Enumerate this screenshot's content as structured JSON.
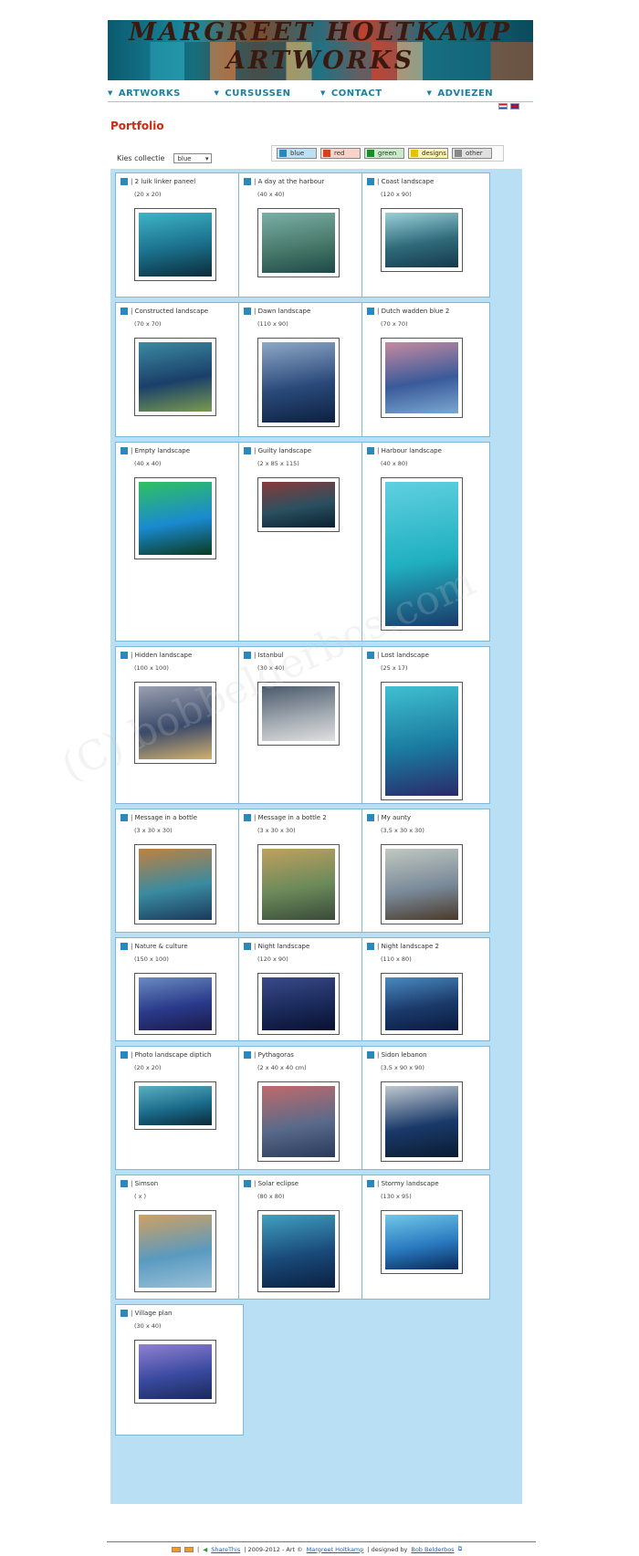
{
  "site_title": "MARGREET HOLTKAMP ARTWORKS",
  "nav": [
    "ARTWORKS",
    "CURSUSSEN",
    "CONTACT",
    "ADVIEZEN"
  ],
  "page_title": "Portfolio",
  "collection": {
    "label": "Kies collectie",
    "selected": "blue"
  },
  "filters": [
    {
      "label": "blue",
      "color": "#2a88bd",
      "bg": "#bde0f4"
    },
    {
      "label": "red",
      "color": "#d64020",
      "bg": "#f7d3c8"
    },
    {
      "label": "green",
      "color": "#1a8c2a",
      "bg": "#c9ebc9"
    },
    {
      "label": "designs",
      "color": "#e6c200",
      "bg": "#fff4b0"
    },
    {
      "label": "other",
      "color": "#888888",
      "bg": "#e0e0e0"
    }
  ],
  "artworks": [
    {
      "title": "| 2 luik linker paneel",
      "size": "(20 x 20)"
    },
    {
      "title": "| A day at the harbour",
      "size": "(40 x 40)"
    },
    {
      "title": "| Coast landscape",
      "size": "(120 x 90)"
    },
    {
      "title": "| Constructed landscape",
      "size": "(70 x 70)"
    },
    {
      "title": "| Dawn landscape",
      "size": "(110 x 90)"
    },
    {
      "title": "| Dutch wadden blue 2",
      "size": "(70 x 70)"
    },
    {
      "title": "| Empty landscape",
      "size": "(40 x 40)"
    },
    {
      "title": "| Guilty landscape",
      "size": "(2 x 85 x 115)"
    },
    {
      "title": "| Harbour landscape",
      "size": "(40 x 80)"
    },
    {
      "title": "| Hidden landscape",
      "size": "(100 x 100)"
    },
    {
      "title": "| Istanbul",
      "size": "(30 x 40)"
    },
    {
      "title": "| Lost landscape",
      "size": "(25 x 17)"
    },
    {
      "title": "| Message in a bottle",
      "size": "(3 x 30 x 30)"
    },
    {
      "title": "| Message in a bottle 2",
      "size": "(3 x 30 x 30)"
    },
    {
      "title": "| My aunty",
      "size": "(3,5 x 30 x 30)"
    },
    {
      "title": "| Nature & culture",
      "size": "(150 x 100)"
    },
    {
      "title": "| Night landscape",
      "size": "(120 x 90)"
    },
    {
      "title": "| Night landscape 2",
      "size": "(110 x 80)"
    },
    {
      "title": "| Photo landscape diptich",
      "size": "(20 x 20)"
    },
    {
      "title": "| Pythagoras",
      "size": "(2 x 40 x 40 cm)"
    },
    {
      "title": "| Sidon lebanon",
      "size": "(3,5 x 90 x 90)"
    },
    {
      "title": "| Simson",
      "size": "( x )"
    },
    {
      "title": "| Solar eclipse",
      "size": "(80 x 80)"
    },
    {
      "title": "| Stormy landscape",
      "size": "(130 x 95)"
    },
    {
      "title": "| Village plan",
      "size": "(30 x 40)"
    }
  ],
  "footer": {
    "share": "ShareThis",
    "years": "| 2009-2012 - Art ©",
    "artist": "Margreet Holtkamp",
    "designed": "| designed by",
    "designer": "Bob Belderbos"
  },
  "watermark": "(C) bobbelderbos.com"
}
